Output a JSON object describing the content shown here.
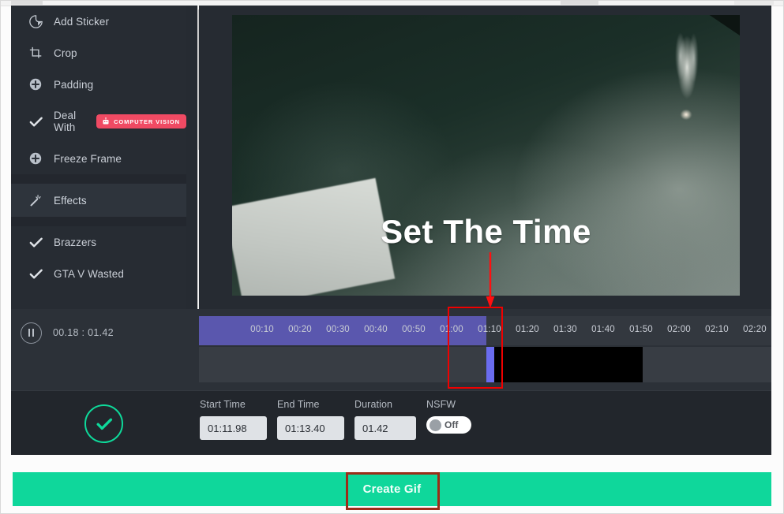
{
  "sidebar": {
    "items": [
      {
        "label": "Add Sticker",
        "icon": "sticker-icon",
        "badge": null,
        "active": false,
        "section": false
      },
      {
        "label": "Crop",
        "icon": "crop-icon",
        "badge": null,
        "active": false,
        "section": false
      },
      {
        "label": "Padding",
        "icon": "plus-circle-icon",
        "badge": null,
        "active": false,
        "section": false
      },
      {
        "label": "Deal With",
        "icon": "check-icon",
        "badge": "COMPUTER VISION",
        "active": false,
        "section": false
      },
      {
        "label": "Freeze Frame",
        "icon": "plus-circle-icon",
        "badge": null,
        "active": false,
        "section": false
      },
      {
        "label": "Effects",
        "icon": "magic-wand-icon",
        "badge": null,
        "active": true,
        "section": true
      },
      {
        "label": "Brazzers",
        "icon": "check-icon",
        "badge": null,
        "active": false,
        "section": false
      },
      {
        "label": "GTA V Wasted",
        "icon": "check-icon",
        "badge": null,
        "active": false,
        "section": false
      }
    ],
    "badge_label": "COMPUTER VISION"
  },
  "preview": {
    "overlay_text": "Set The Time",
    "annotation_arrow": "red-down-arrow"
  },
  "timeline": {
    "pause_icon": "pause-icon",
    "current_time": "00.18",
    "time_separator": ":",
    "total_time": "01.42",
    "time_display": "00.18  :  01.42",
    "ruler_ticks": [
      "00:10",
      "00:20",
      "00:30",
      "00:40",
      "00:50",
      "01:00",
      "01:10",
      "01:20",
      "01:30",
      "01:40",
      "01:50",
      "02:00",
      "02:10",
      "02:20"
    ],
    "progress_color": "#5a57ae",
    "playhead_color": "#6a6cf0",
    "selection_highlight_color": "#f00000"
  },
  "form": {
    "status_icon": "check-circle-icon",
    "start_time": {
      "label": "Start Time",
      "value": "01:11.98"
    },
    "end_time": {
      "label": "End Time",
      "value": "01:13.40"
    },
    "duration": {
      "label": "Duration",
      "value": "01.42"
    },
    "nsfw": {
      "label": "NSFW",
      "value": "Off"
    }
  },
  "cta": {
    "label": "Create Gif",
    "color": "#0fd79b",
    "highlight_color": "#9b2d18"
  }
}
